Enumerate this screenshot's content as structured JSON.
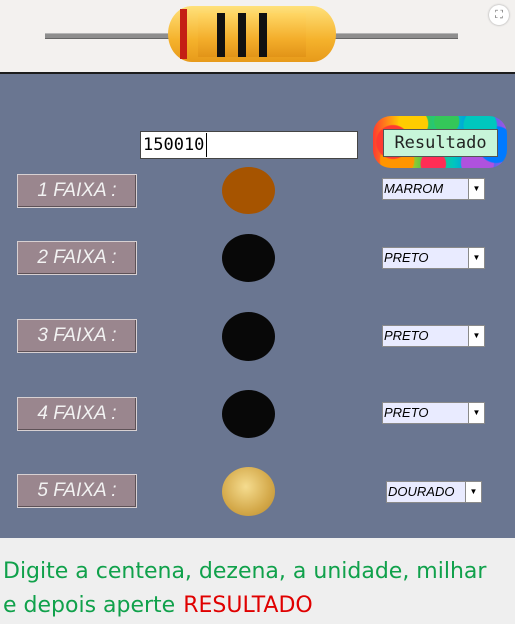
{
  "resistor": {
    "band_colors": [
      "#c41f14",
      "#111111",
      "#111111",
      "#111111"
    ],
    "body_color": "#f5b22c",
    "expand_icon": "expand-icon"
  },
  "calculator": {
    "value_input": "150010",
    "result_button_label": "Resultado"
  },
  "bands": [
    {
      "label": "1 FAIXA :",
      "color": "#a65400",
      "selected": "MARROM"
    },
    {
      "label": "2 FAIXA :",
      "color": "#080808",
      "selected": "PRETO"
    },
    {
      "label": "3 FAIXA :",
      "color": "#080808",
      "selected": "PRETO"
    },
    {
      "label": "4 FAIXA :",
      "color": "#080808",
      "selected": "PRETO"
    },
    {
      "label": "5 FAIXA :",
      "color": "#d4a94a",
      "selected": "DOURADO"
    }
  ],
  "instructions": {
    "line1": "Digite a centena, dezena, a unidade, milhar",
    "line2_prefix": "e depois aperte",
    "line2_highlight": "RESULTADO"
  }
}
